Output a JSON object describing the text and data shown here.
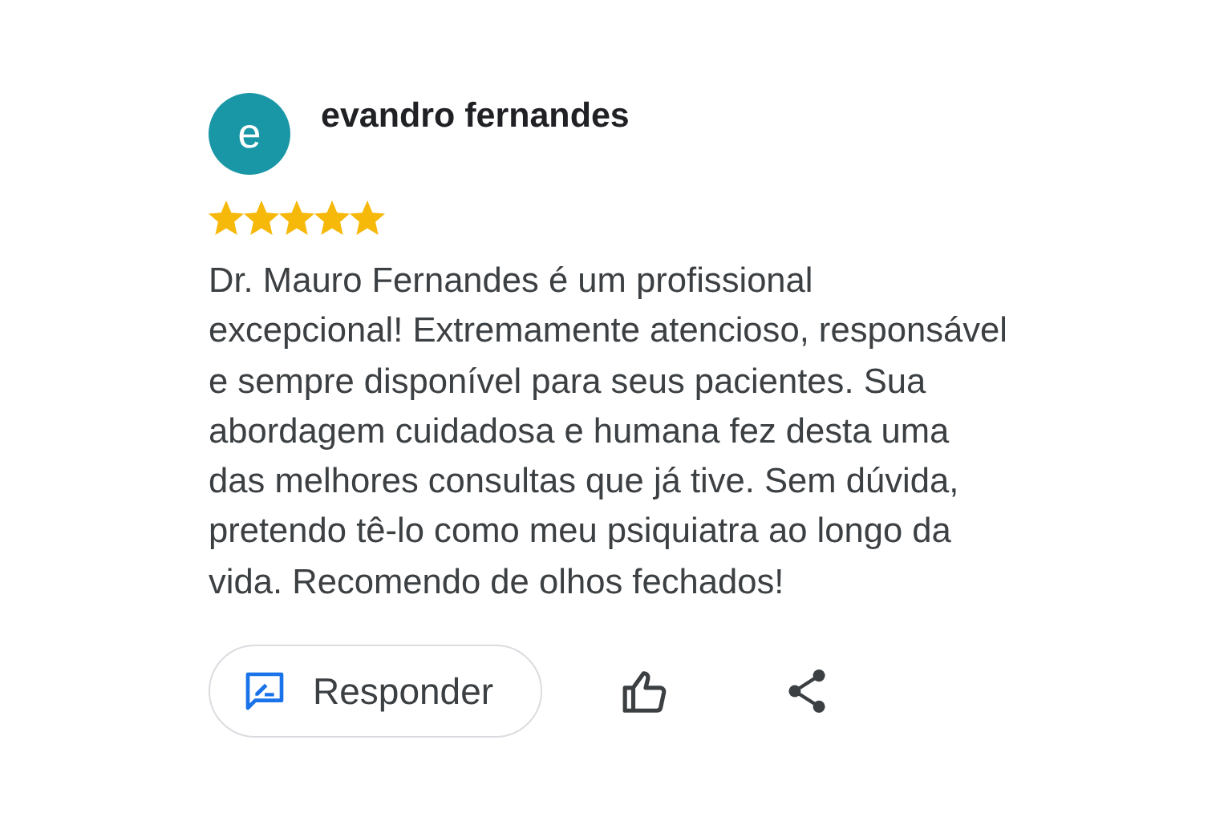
{
  "review": {
    "avatar_letter": "e",
    "author": "evandro fernandes",
    "stars": 5,
    "text": "Dr. Mauro Fernandes é um profissional excepcional! Extremamente atencioso, responsável e sempre disponível para seus pacientes. Sua abordagem cuidadosa e humana fez desta uma das melhores consultas que já tive. Sem dúvida, pretendo tê-lo como meu psiquiatra ao longo da vida. Recomendo de olhos fechados!"
  },
  "actions": {
    "reply_label": "Responder"
  }
}
